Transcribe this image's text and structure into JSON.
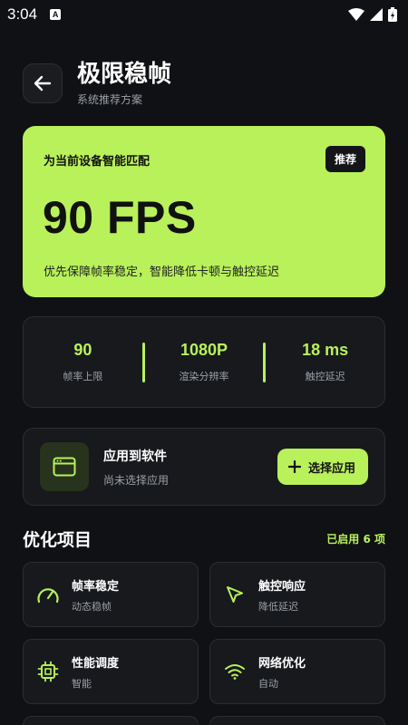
{
  "status_bar": {
    "time": "3:04",
    "notif_glyph": "A",
    "icons": [
      "wifi-icon",
      "signal-icon",
      "battery-icon"
    ]
  },
  "header": {
    "title": "极限稳帧",
    "subtitle": "系统推荐方案"
  },
  "hero": {
    "caption": "为当前设备智能匹配",
    "badge": "推荐",
    "fps": "90 FPS",
    "description": "优先保障帧率稳定，智能降低卡顿与触控延迟"
  },
  "stats": [
    {
      "value": "90",
      "label": "帧率上限"
    },
    {
      "value": "1080P",
      "label": "渲染分辨率"
    },
    {
      "value": "18 ms",
      "label": "触控延迟"
    }
  ],
  "apply": {
    "title": "应用到软件",
    "subtitle": "尚未选择应用",
    "button": "选择应用"
  },
  "section": {
    "title": "优化项目",
    "count": "已启用 6 项"
  },
  "options": [
    {
      "title": "帧率稳定",
      "subtitle": "动态稳帧",
      "icon": "speedometer-icon"
    },
    {
      "title": "触控响应",
      "subtitle": "降低延迟",
      "icon": "pointer-icon"
    },
    {
      "title": "性能调度",
      "subtitle": "智能",
      "icon": "chip-icon"
    },
    {
      "title": "网络优化",
      "subtitle": "自动",
      "icon": "wifi-icon"
    }
  ],
  "colors": {
    "accent": "#b8f15a",
    "background": "#101114",
    "card": "#17191d"
  }
}
